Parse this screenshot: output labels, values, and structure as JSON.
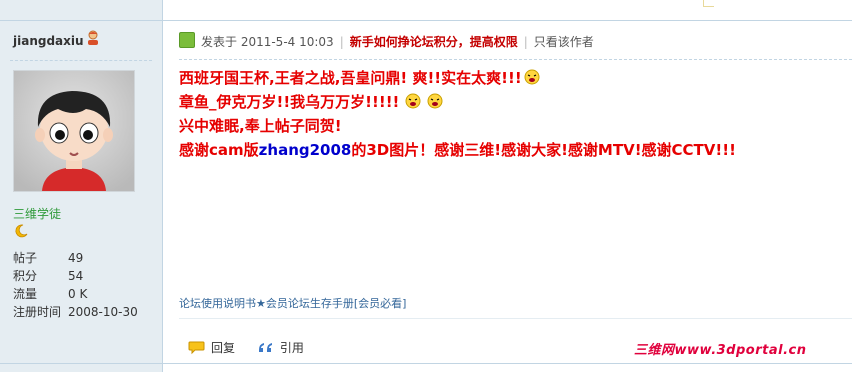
{
  "author": {
    "name": "jiangdaxiu",
    "group": "三维学徒",
    "stats": [
      {
        "label": "帖子",
        "value": "49"
      },
      {
        "label": "积分",
        "value": "54"
      },
      {
        "label": "流量",
        "value": "0 K"
      },
      {
        "label": "注册时间",
        "value": "2008-10-30"
      }
    ]
  },
  "post": {
    "posted_label": "发表于 2011-5-4 10:03",
    "notice_link": "新手如何挣论坛积分，提高权限",
    "author_only": "只看该作者",
    "lines": [
      "西班牙国王杯,王者之战,吾皇问鼎! 爽!!实在太爽!!!",
      "章鱼_伊克万岁!!我乌万万岁!!!!!",
      "兴中难眠,奉上帖子同贺!"
    ],
    "thanks_prefix": "感谢cam版",
    "thanks_user": "zhang2008",
    "thanks_suffix": "的3D图片！感谢三维!感谢大家!感谢MTV!感谢CCTV!!!",
    "footer_link": "论坛使用说明书★会员论坛生存手册[会员必看]"
  },
  "actions": {
    "reply": "回复",
    "quote": "引用"
  },
  "watermark": "三维网www.3dportal.cn",
  "colors": {
    "sidebar_bg": "#e5edf2",
    "post_red": "#e60000",
    "user_blue": "#0000cc",
    "group_green": "#2f9a3a"
  }
}
